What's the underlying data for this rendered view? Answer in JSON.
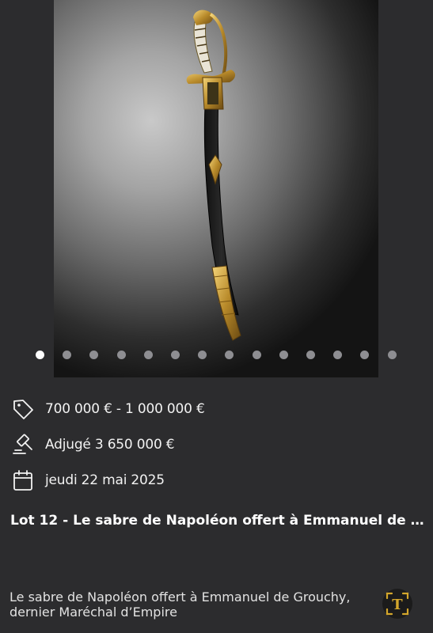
{
  "carousel": {
    "slide_count": 14,
    "active_index": 0,
    "image_alt": "sabre"
  },
  "details": {
    "estimate": "700 000 € - 1 000 000 €",
    "estimate_icon": "price-tag-icon",
    "hammer_price": "Adjugé 3 650 000 €",
    "hammer_icon": "auction-gavel-icon",
    "date": "jeudi 22 mai 2025",
    "date_icon": "calendar-icon"
  },
  "lot": {
    "title": "Lot 12 - Le sabre de Napoléon offert à Emmanuel de ..."
  },
  "description": {
    "line1": "Le sabre de Napoléon offert à Emmanuel de Grouchy,",
    "line2": "dernier Maréchal d’Empire"
  },
  "fab": {
    "icon": "text-scan-icon",
    "glyph": "T",
    "accent_color": "#d4a72c"
  }
}
